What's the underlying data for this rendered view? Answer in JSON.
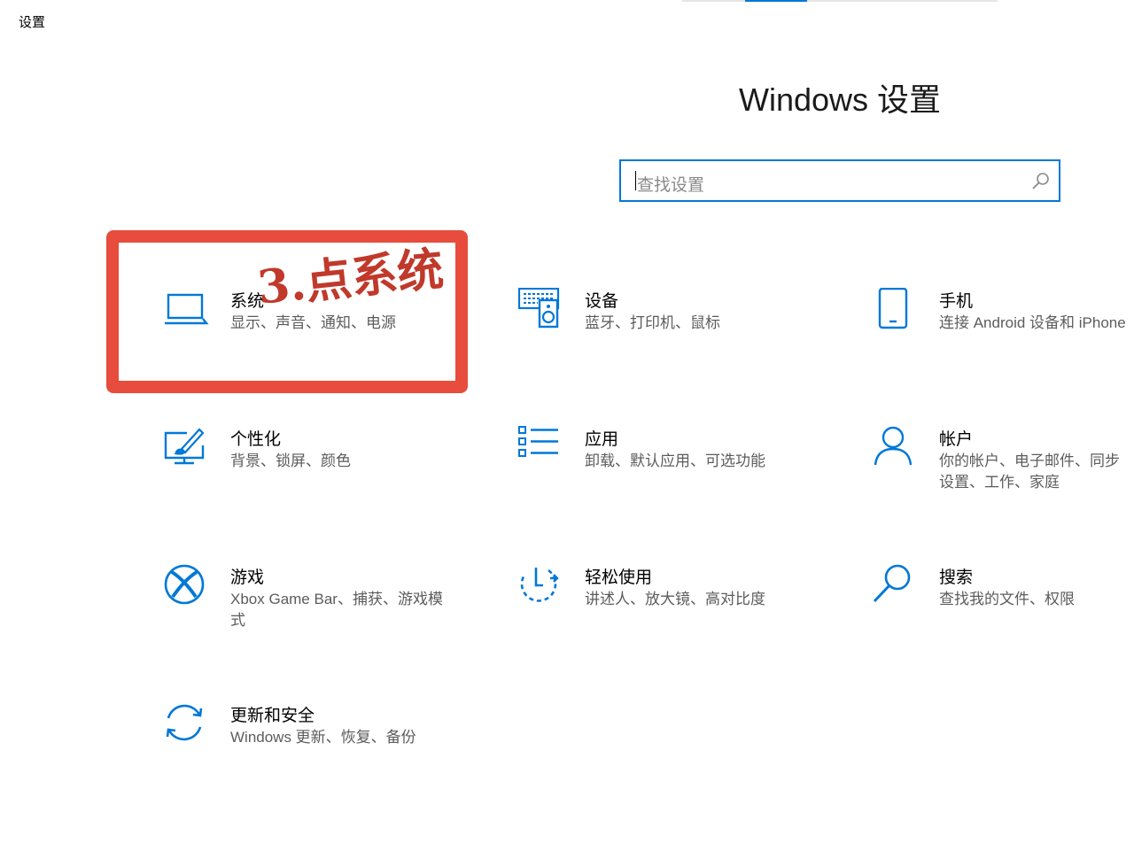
{
  "window": {
    "title": "设置"
  },
  "header": {
    "title": "Windows 设置"
  },
  "search": {
    "placeholder": "查找设置"
  },
  "tiles": [
    {
      "name": "系统",
      "desc": "显示、声音、通知、电源",
      "icon": "laptop-icon"
    },
    {
      "name": "设备",
      "desc": "蓝牙、打印机、鼠标",
      "icon": "devices-icon"
    },
    {
      "name": "手机",
      "desc": "连接 Android 设备和 iPhone",
      "icon": "phone-icon"
    },
    {
      "name": "个性化",
      "desc": "背景、锁屏、颜色",
      "icon": "personalization-icon"
    },
    {
      "name": "应用",
      "desc": "卸载、默认应用、可选功能",
      "icon": "apps-icon"
    },
    {
      "name": "帐户",
      "desc": "你的帐户、电子邮件、同步设置、工作、家庭",
      "icon": "account-icon"
    },
    {
      "name": "游戏",
      "desc": "Xbox Game Bar、捕获、游戏模式",
      "icon": "xbox-icon"
    },
    {
      "name": "轻松使用",
      "desc": "讲述人、放大镜、高对比度",
      "icon": "ease-of-access-icon"
    },
    {
      "name": "搜索",
      "desc": "查找我的文件、权限",
      "icon": "search-icon"
    },
    {
      "name": "更新和安全",
      "desc": "Windows 更新、恢复、备份",
      "icon": "update-icon"
    }
  ],
  "annotation": {
    "text": "3.点系统",
    "color": "#e74c3c"
  },
  "colors": {
    "accent": "#0078d7",
    "highlight": "#e74c3c"
  }
}
